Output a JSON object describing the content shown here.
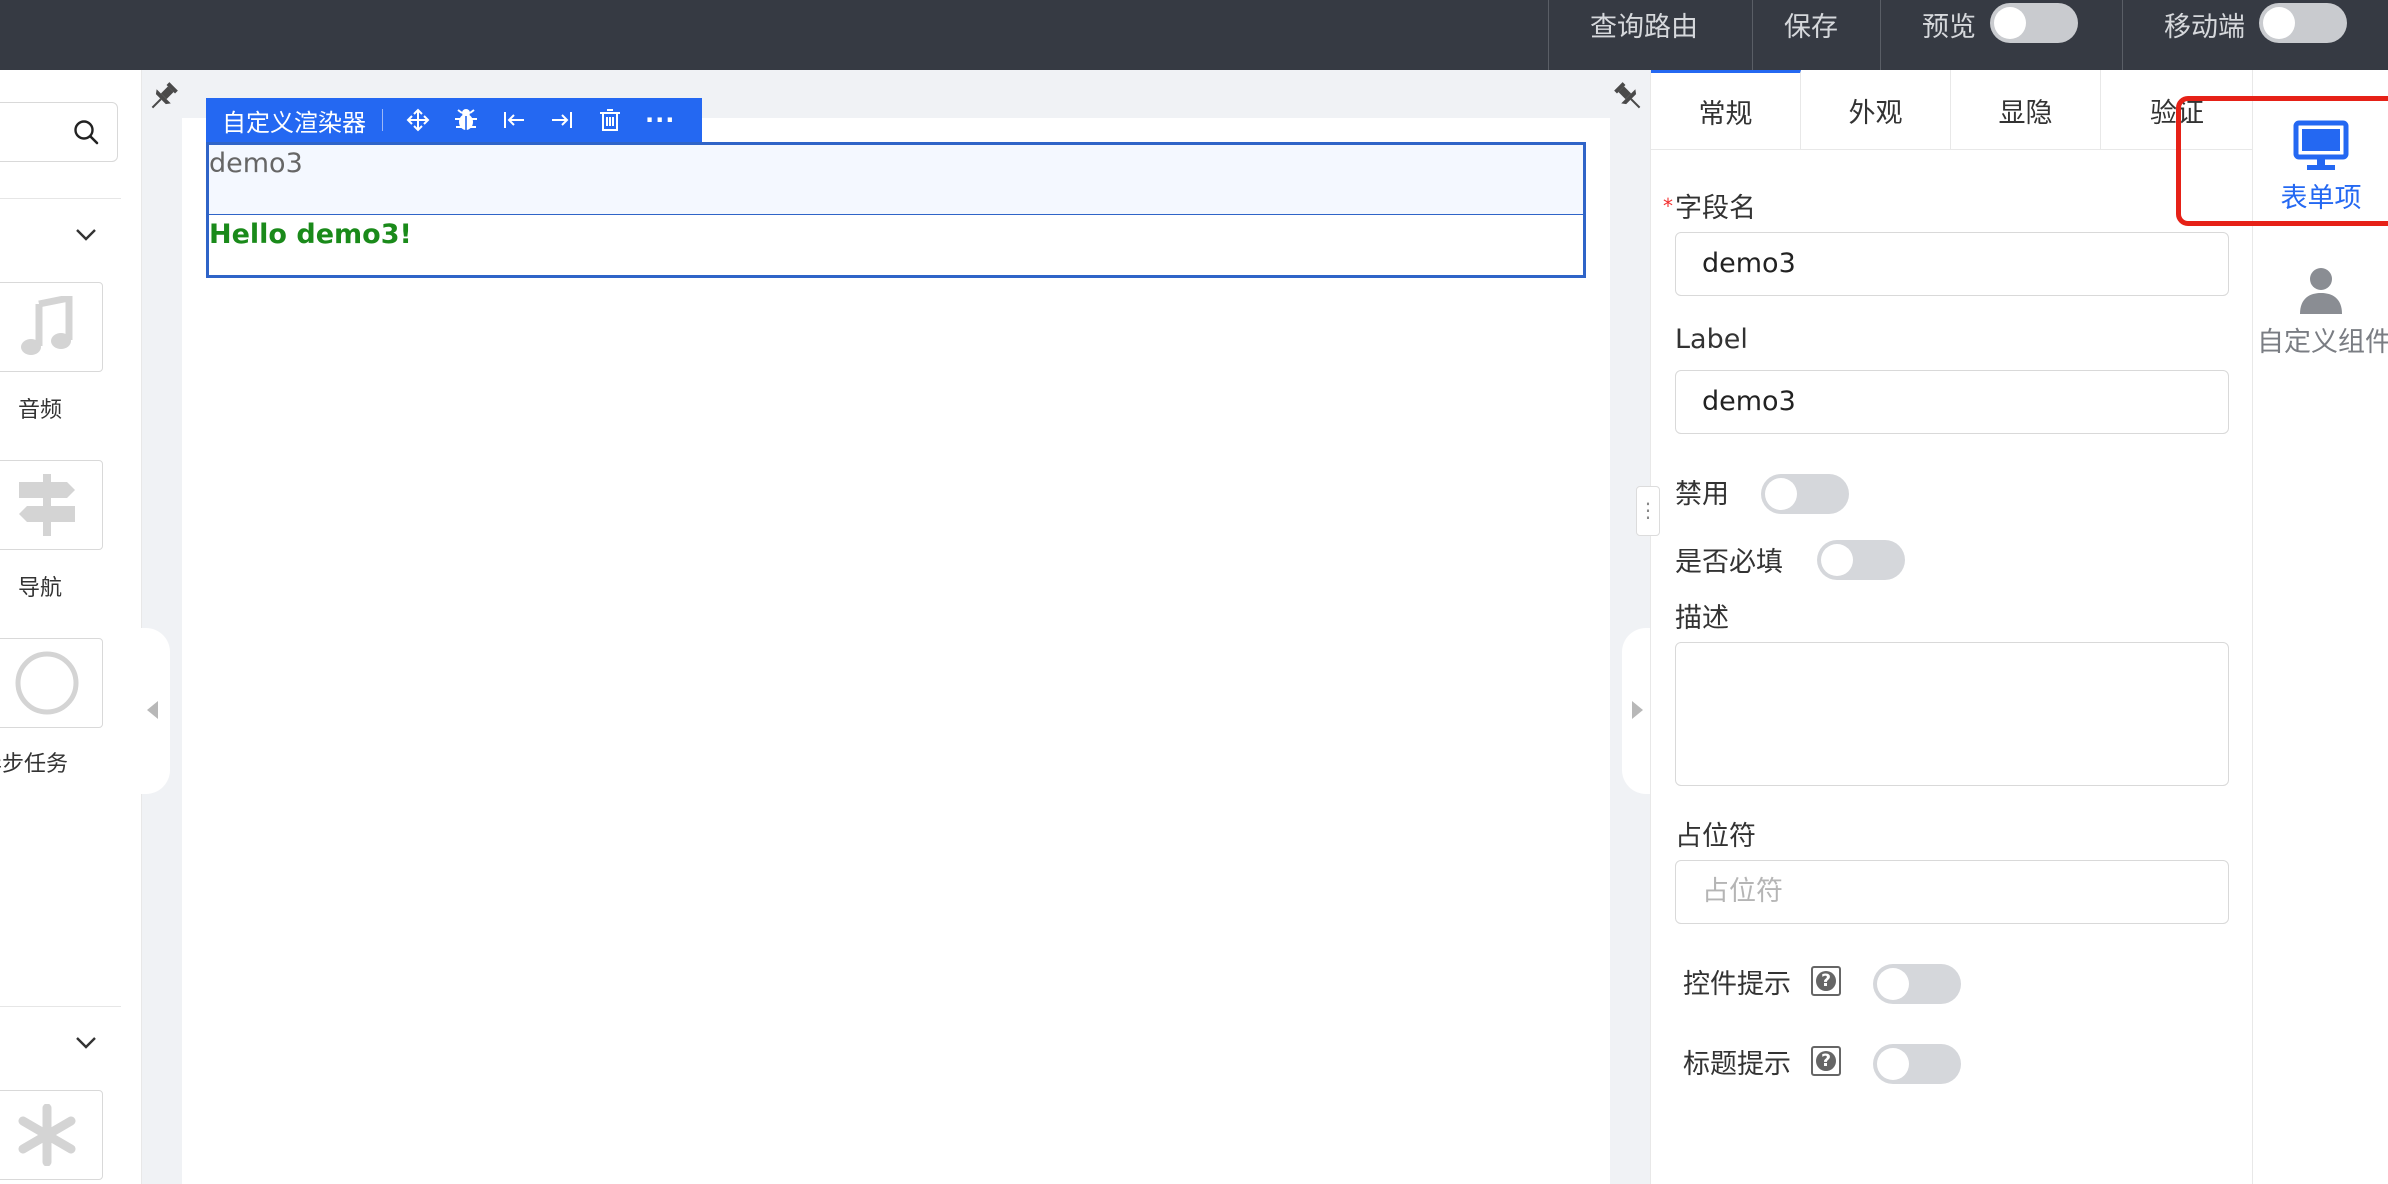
{
  "topbar": {
    "query_route": "查询路由",
    "save": "保存",
    "preview": "预览",
    "mobile": "移动端"
  },
  "left_panel": {
    "components": [
      {
        "label": "音频",
        "icon": "music-note-icon"
      },
      {
        "label": "导航",
        "icon": "signpost-icon"
      },
      {
        "label": "异步任务",
        "icon": "circle-icon"
      }
    ],
    "second_section_icon": "asterisk-icon"
  },
  "canvas": {
    "toolbar_title": "自定义渲染器",
    "toolbar_more": "···",
    "field_label": "demo3",
    "field_value": "Hello demo3!"
  },
  "props": {
    "tabs": [
      "常规",
      "外观",
      "显隐",
      "验证"
    ],
    "field_name_label": "字段名",
    "required_mark": "*",
    "field_name_value": "demo3",
    "label_label": "Label",
    "label_value": "demo3",
    "disabled_label": "禁用",
    "required_label": "是否必填",
    "description_label": "描述",
    "placeholder_label": "占位符",
    "placeholder_placeholder": "占位符",
    "control_hint_label": "控件提示",
    "title_hint_label": "标题提示",
    "help_glyph": "?",
    "splitter_glyph": "⋮"
  },
  "far_right": {
    "form_item": "表单项",
    "custom_component": "自定义组件"
  },
  "colors": {
    "accent": "#2468f2",
    "topbar": "#363a43",
    "success_text": "#1a8a1a",
    "highlight": "#e62117"
  }
}
